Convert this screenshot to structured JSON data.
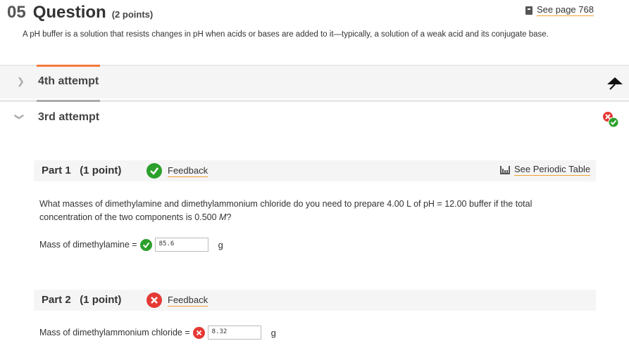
{
  "question": {
    "number": "05",
    "title": "Question",
    "points": "(2 points)",
    "see_page": "See page 768",
    "description": "A pH buffer is a solution that resists changes in pH when acids or bases are added to it—typically, a solution of a weak acid and its conjugate base."
  },
  "attempts": [
    {
      "label": "4th attempt",
      "expanded": false
    },
    {
      "label": "3rd attempt",
      "expanded": true
    }
  ],
  "parts": [
    {
      "title": "Part 1   (1 point)",
      "status": "correct",
      "feedback_label": "Feedback",
      "periodic_label": "See Periodic Table",
      "question_line1": "What masses of dimethylamine and dimethylammonium chloride do you need to prepare 4.00 L of pH = 12.00 buffer if the total",
      "question_line2": "concentration of the two components is 0.500 ",
      "question_unit": "M",
      "question_end": "?",
      "answer_label": "Mass of dimethylamine =",
      "answer_value": "85.6",
      "answer_unit": "g"
    },
    {
      "title": "Part 2   (1 point)",
      "status": "incorrect",
      "feedback_label": "Feedback",
      "answer_label": "Mass of dimethylammonium chloride =",
      "answer_value": "8.32",
      "answer_unit": "g"
    }
  ],
  "colors": {
    "accent_orange": "#f37a3a",
    "correct_green": "#2ca02c",
    "incorrect_red": "#e53935",
    "underline": "#f0a030"
  },
  "icons": [
    "book-icon",
    "chevron-right-icon",
    "chevron-down-icon",
    "flag-icon",
    "attempt-status-icon",
    "check-icon",
    "x-icon",
    "periodic-table-icon"
  ]
}
